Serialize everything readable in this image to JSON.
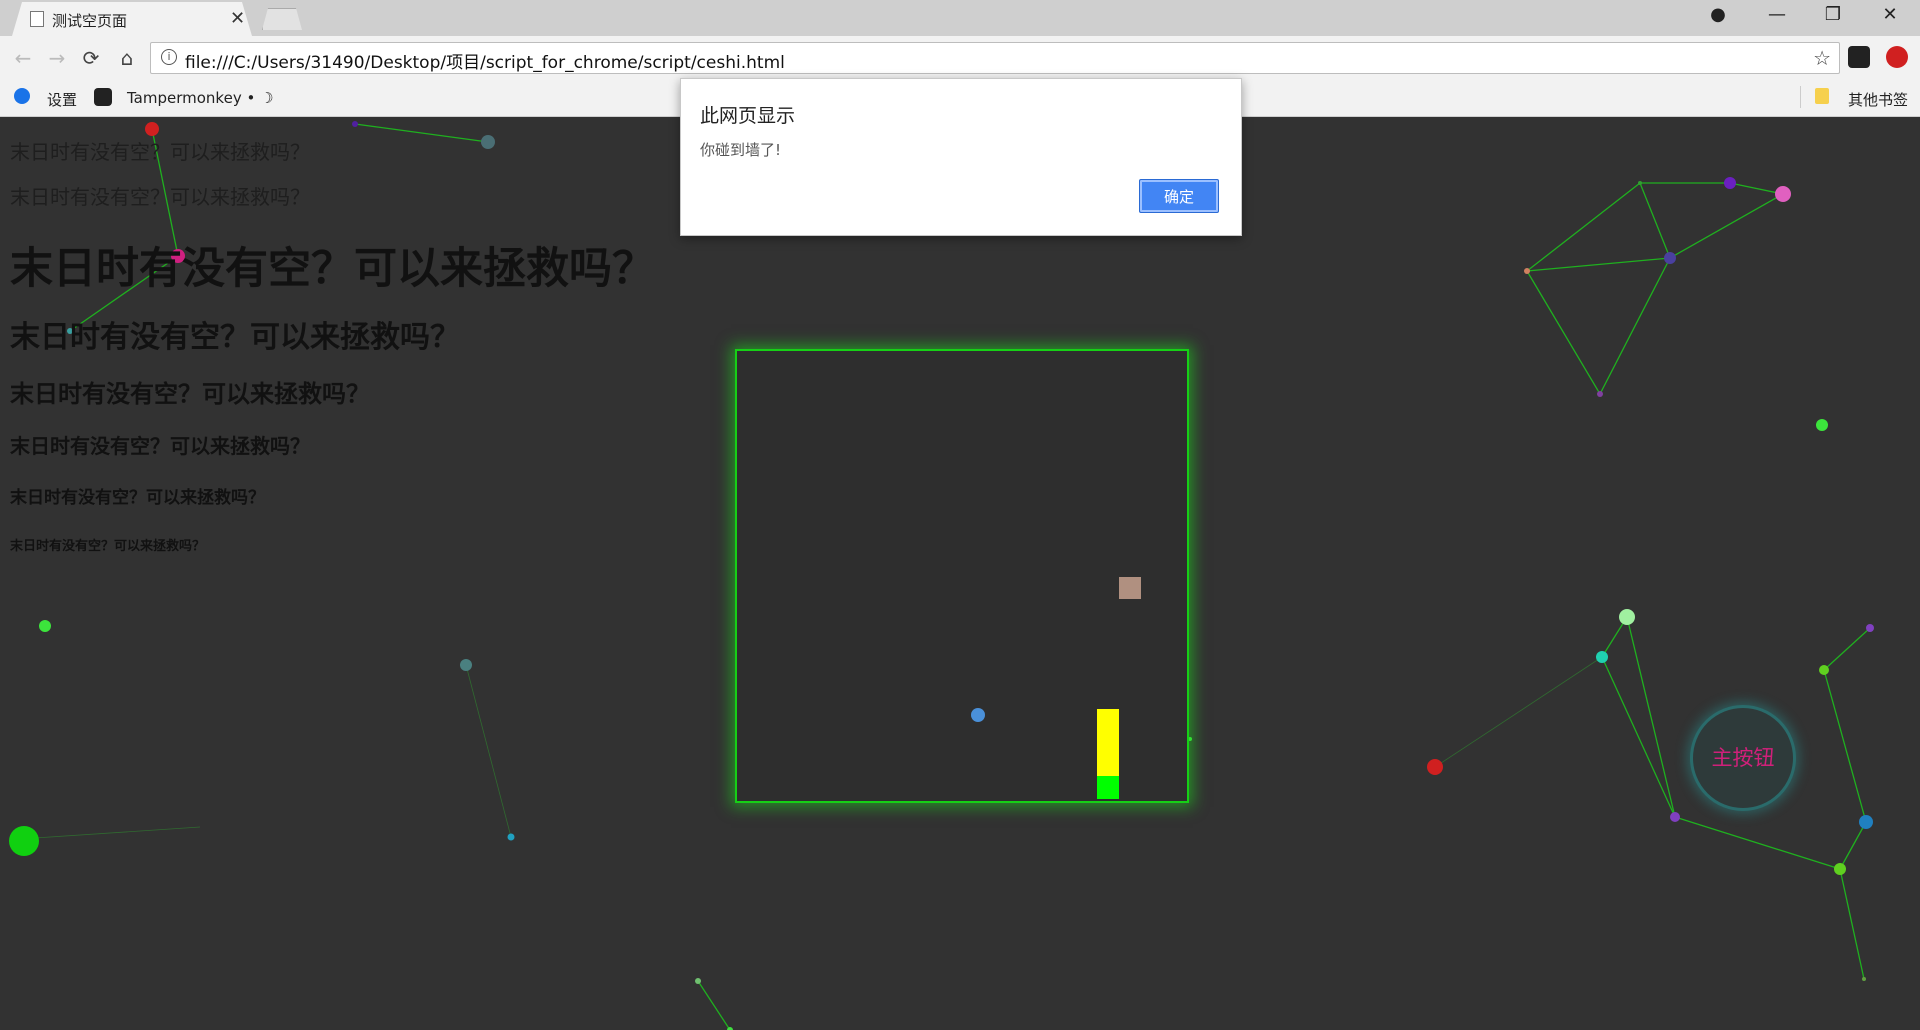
{
  "tab": {
    "title": "测试空页面",
    "close_glyph": "✕"
  },
  "window_controls": {
    "account": "●",
    "minimize": "—",
    "restore": "❐",
    "close": "✕"
  },
  "nav": {
    "back": "←",
    "forward": "→",
    "reload": "⟳",
    "home": "⌂"
  },
  "omnibox": {
    "info": "i",
    "url": "file:///C:/Users/31490/Desktop/项目/script_for_chrome/script/ceshi.html",
    "star": "☆"
  },
  "bookmarks": {
    "settings": "设置",
    "tampermonkey": "Tampermonkey • ☽",
    "other": "其他书签"
  },
  "headings": [
    "末日时有没有空？可以来拯救吗？",
    "末日时有没有空？可以来拯救吗？",
    "末日时有没有空？可以来拯救吗？",
    "末日时有没有空？可以来拯救吗？",
    "末日时有没有空？可以来拯救吗？",
    "末日时有没有空？可以来拯救吗？",
    "末日时有没有空？可以来拯救吗？",
    "末日时有没有空？可以来拯救吗？"
  ],
  "main_button": {
    "label": "主按钮"
  },
  "dialog": {
    "title": "此网页显示",
    "message": "你碰到墙了!",
    "ok": "确定"
  },
  "colors": {
    "background": "#323232",
    "game_border": "#16d016",
    "ok_button": "#4285f4",
    "main_button_text": "#d0207a",
    "paddle": "#ffff00",
    "paddle_base": "#00ff00",
    "ball": "#4a90d9",
    "target": "#b09080"
  }
}
